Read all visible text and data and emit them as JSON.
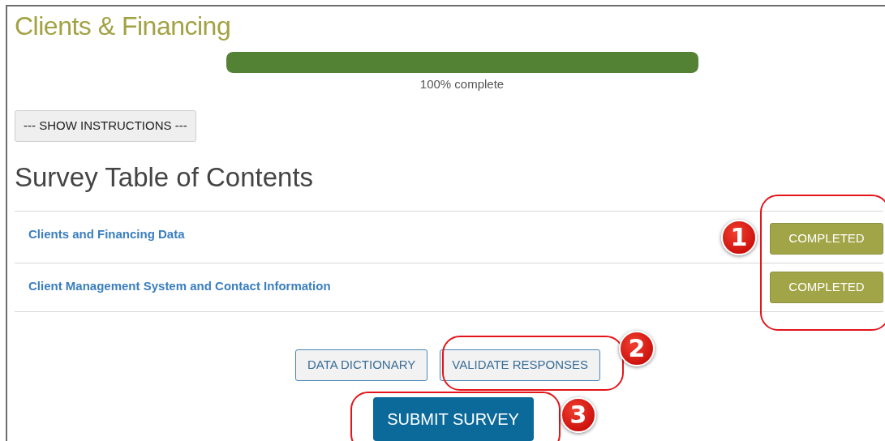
{
  "page_title": "Clients & Financing",
  "progress": {
    "level": 1,
    "label": "100% complete"
  },
  "instructions_button": "--- SHOW INSTRUCTIONS ---",
  "toc_heading": "Survey Table of Contents",
  "sections": [
    {
      "title": "Clients and Financing Data",
      "status": "COMPLETED"
    },
    {
      "title": "Client Management System and Contact Information",
      "status": "COMPLETED"
    }
  ],
  "buttons": [
    "DATA DICTIONARY",
    "VALIDATE RESPONSES"
  ],
  "submit_button": "SUBMIT SURVEY",
  "callouts": [
    {
      "number": "1"
    },
    {
      "number": "2"
    },
    {
      "number": "3"
    }
  ]
}
